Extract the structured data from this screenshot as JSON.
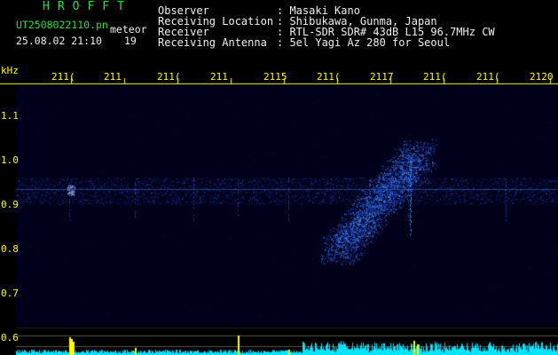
{
  "header": {
    "app_title": "HROFFT",
    "filename": "UT2508022110.pn",
    "mode": "meteor",
    "datetime": "25.08.02 21:10",
    "count": "19"
  },
  "info": {
    "rows": [
      {
        "label": "Observer",
        "value": ": Masaki Kano"
      },
      {
        "label": "Receiving Location",
        "value": ": Shibukawa, Gunma, Japan"
      },
      {
        "label": "Receiver",
        "value": ": RTL-SDR SDR# 43dB L15 96.7MHz CW"
      },
      {
        "label": "Receiving Antenna",
        "value": ": 5el Yagi Az 280 for Seoul"
      }
    ]
  },
  "time_axis": {
    "ticks": [
      "211(",
      "211",
      "211(",
      "211",
      "2115",
      "211(",
      "2117",
      "211(",
      "211(",
      "2120"
    ]
  },
  "freq_axis": {
    "unit": "kHz",
    "ticks": [
      "1.1",
      "1.0",
      "0.9",
      "0.8",
      "0.7",
      "0.6"
    ]
  },
  "colors": {
    "background": "#000000",
    "header_green": "#22e03a",
    "header_white": "#f0f0f0",
    "axis_yellow": "#ffff00",
    "signal_blue": "#2a6cff",
    "noise_cyan": "#00e5ff",
    "plot_bg": "#00001a"
  }
}
